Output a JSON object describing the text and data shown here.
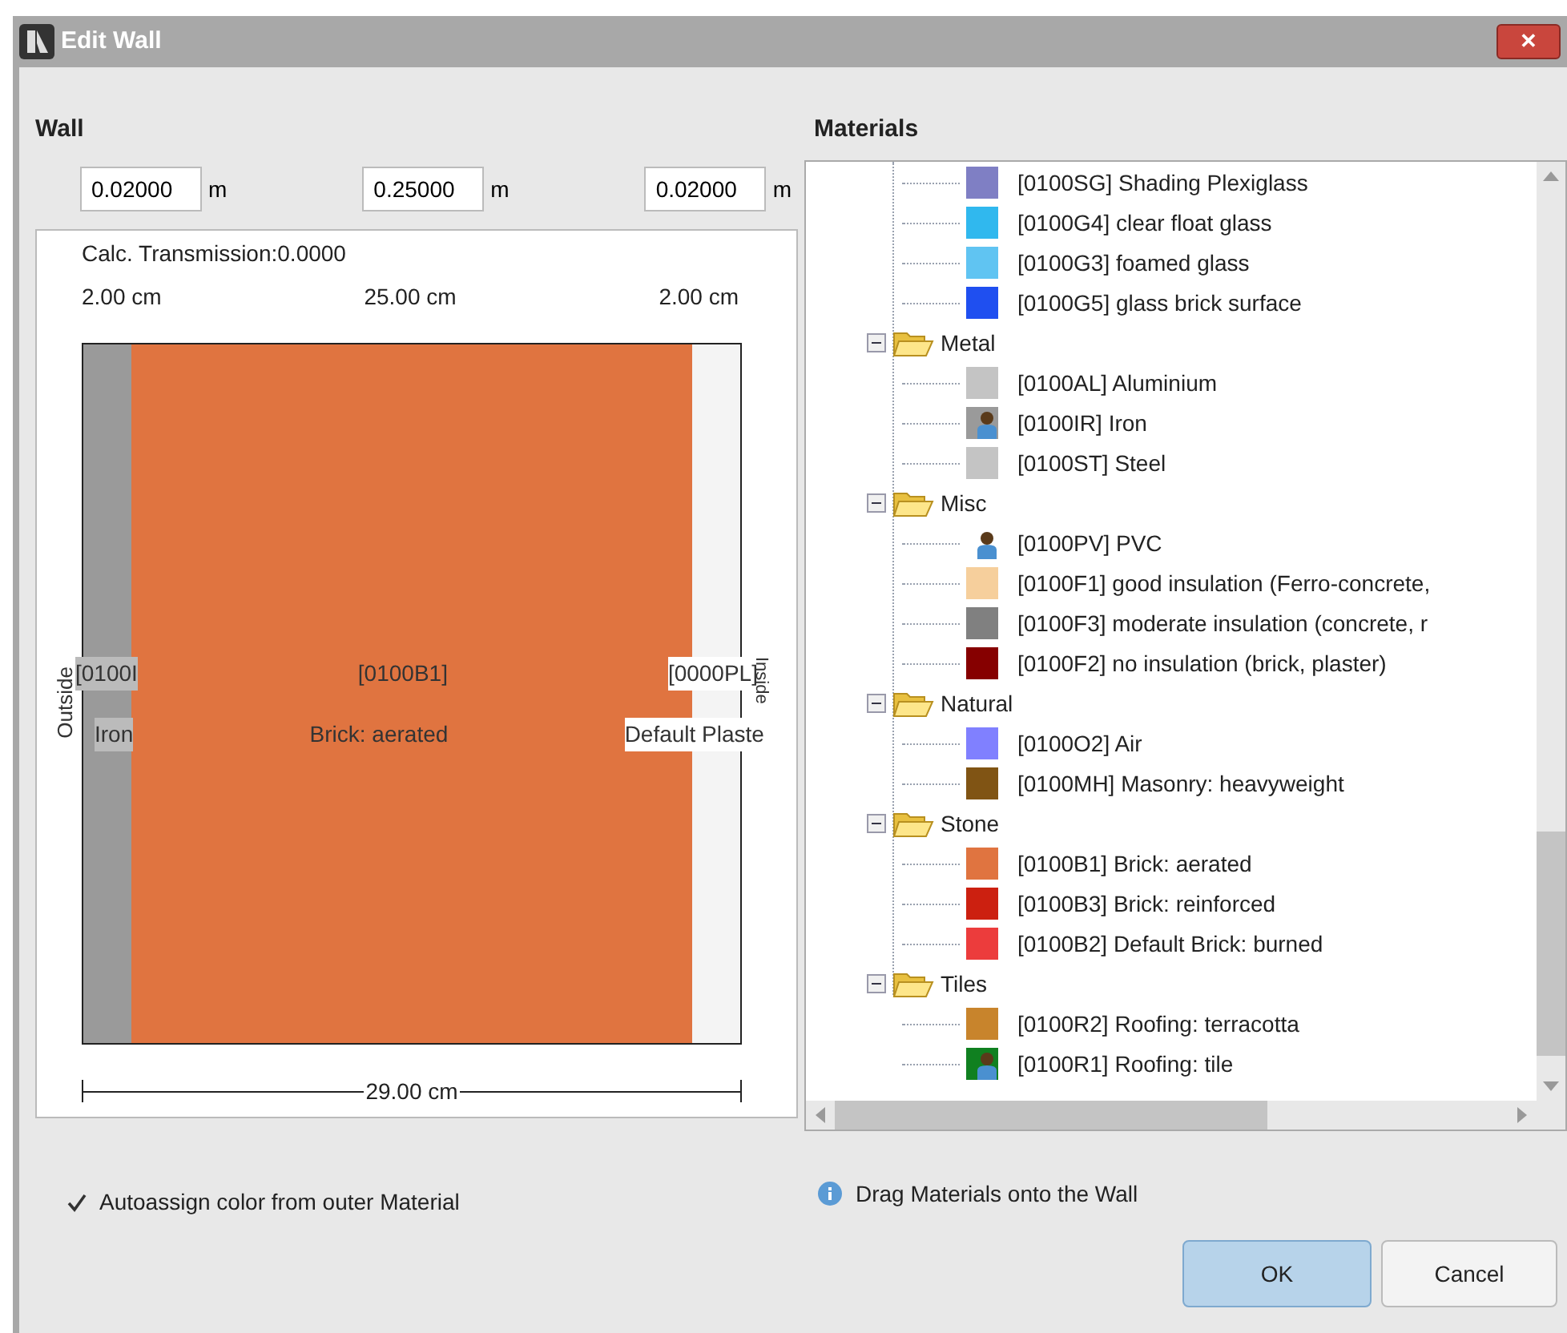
{
  "window": {
    "title": "Edit Wall",
    "close": "✕"
  },
  "wall": {
    "heading": "Wall",
    "thickness_fields": [
      {
        "value": "0.02000",
        "unit": "m"
      },
      {
        "value": "0.25000",
        "unit": "m"
      },
      {
        "value": "0.02000",
        "unit": "m"
      }
    ],
    "transmission": "Calc.  Transmission:0.0000",
    "outside_label": "Outside",
    "inside_label": "Inside",
    "layers": [
      {
        "width_label": "2.00 cm",
        "code": "[0100I",
        "name": "Iron",
        "color": "#9a9a9a"
      },
      {
        "width_label": "25.00 cm",
        "code": "[0100B1]",
        "name": "Brick: aerated",
        "color": "#e07440"
      },
      {
        "width_label": "2.00 cm",
        "code": "[0000PL]",
        "name": "Default Plaste",
        "color": "#f4f4f4"
      }
    ],
    "total": "29.00 cm",
    "autoassign": {
      "label": "Autoassign color from outer Material",
      "checked": true
    }
  },
  "materials": {
    "heading": "Materials",
    "orphan_items": [
      {
        "kind": "swatch",
        "label": "[0100SG] Shading Plexiglass",
        "color": "#7f7fc4"
      },
      {
        "kind": "swatch",
        "label": "[0100G4] clear float glass",
        "color": "#30b8ee"
      },
      {
        "kind": "swatch",
        "label": "[0100G3] foamed glass",
        "color": "#60c4f2"
      },
      {
        "kind": "swatch",
        "label": "[0100G5] glass brick surface",
        "color": "#1f4ff0"
      }
    ],
    "groups": [
      {
        "label": "Metal",
        "expanded": true,
        "children": [
          {
            "kind": "swatch",
            "label": "[0100AL] Aluminium",
            "color": "#c4c4c4"
          },
          {
            "kind": "user",
            "label": "[0100IR] Iron",
            "color": "#9a9a9a"
          },
          {
            "kind": "swatch",
            "label": "[0100ST] Steel",
            "color": "#c4c4c4"
          }
        ]
      },
      {
        "label": "Misc",
        "expanded": true,
        "children": [
          {
            "kind": "user",
            "label": "[0100PV] PVC"
          },
          {
            "kind": "swatch",
            "label": "[0100F1] good insulation (Ferro-concrete,",
            "color": "#f6cf9c"
          },
          {
            "kind": "swatch",
            "label": "[0100F3] moderate insulation (concrete, r",
            "color": "#808080"
          },
          {
            "kind": "swatch",
            "label": "[0100F2] no insulation (brick, plaster)",
            "color": "#860000"
          }
        ]
      },
      {
        "label": "Natural",
        "expanded": true,
        "children": [
          {
            "kind": "swatch",
            "label": "[0100O2] Air",
            "color": "#8080ff"
          },
          {
            "kind": "swatch",
            "label": "[0100MH] Masonry: heavyweight",
            "color": "#805414"
          }
        ]
      },
      {
        "label": "Stone",
        "expanded": true,
        "children": [
          {
            "kind": "swatch",
            "label": "[0100B1] Brick: aerated",
            "color": "#e07440"
          },
          {
            "kind": "swatch",
            "label": "[0100B3] Brick: reinforced",
            "color": "#cc2010"
          },
          {
            "kind": "swatch",
            "label": "[0100B2] Default Brick: burned",
            "color": "#ec3c3c"
          }
        ]
      },
      {
        "label": "Tiles",
        "expanded": true,
        "children": [
          {
            "kind": "swatch",
            "label": "[0100R2] Roofing: terracotta",
            "color": "#c8842c"
          },
          {
            "kind": "user",
            "label": "[0100R1] Roofing: tile",
            "color": "#108020"
          }
        ]
      }
    ],
    "hint": "Drag Materials onto the Wall"
  },
  "buttons": [
    {
      "label": "OK",
      "default": true
    },
    {
      "label": "Cancel",
      "default": false
    }
  ]
}
